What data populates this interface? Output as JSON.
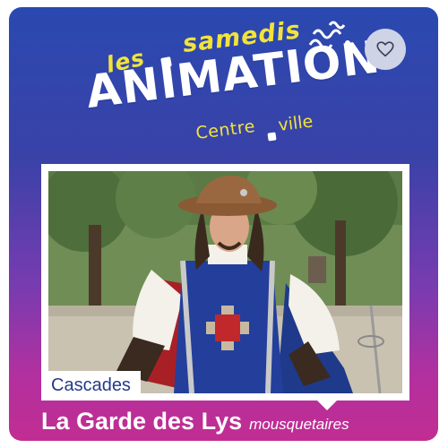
{
  "logo": {
    "line1_word1": "les",
    "line1_word2": "samedis",
    "main_word": "ANIMATION",
    "line3_word1": "Centre",
    "line3_word2": "ville"
  },
  "favorite_button": {
    "icon": "heart-outline-icon"
  },
  "event": {
    "location": "Cascades",
    "title": "La Garde des Lys",
    "subtitle": "mousquetaires"
  },
  "colors": {
    "gradient_top": "#2a49b0",
    "gradient_bottom": "#c12d92",
    "logo_yellow": "#f2e33a",
    "location_text": "#233a8a"
  }
}
